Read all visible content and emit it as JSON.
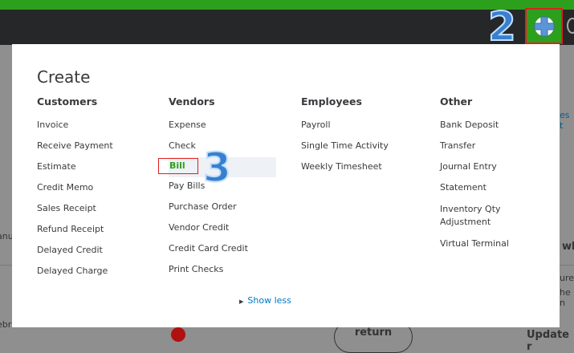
{
  "header": {
    "create_button_icon": "plus-icon"
  },
  "annotations": {
    "step2": "2",
    "step3": "3"
  },
  "background_fragments": [
    "es t",
    "anu",
    "ebr",
    "wh",
    "ure",
    "he n",
    "return",
    "Update r"
  ],
  "menu": {
    "title": "Create",
    "columns": [
      {
        "heading": "Customers",
        "items": [
          "Invoice",
          "Receive Payment",
          "Estimate",
          "Credit Memo",
          "Sales Receipt",
          "Refund Receipt",
          "Delayed Credit",
          "Delayed Charge"
        ]
      },
      {
        "heading": "Vendors",
        "items": [
          "Expense",
          "Check",
          "Bill",
          "Pay Bills",
          "Purchase Order",
          "Vendor Credit",
          "Credit Card Credit",
          "Print Checks"
        ],
        "selected": "Bill"
      },
      {
        "heading": "Employees",
        "items": [
          "Payroll",
          "Single Time Activity",
          "Weekly Timesheet"
        ]
      },
      {
        "heading": "Other",
        "items": [
          "Bank Deposit",
          "Transfer",
          "Journal Entry",
          "Statement",
          "Inventory Qty Adjustment",
          "Virtual Terminal"
        ]
      }
    ],
    "show_less": "Show less"
  },
  "colors": {
    "brand": "#2ca01c",
    "link": "#0077c5",
    "highlight": "#e02020"
  }
}
